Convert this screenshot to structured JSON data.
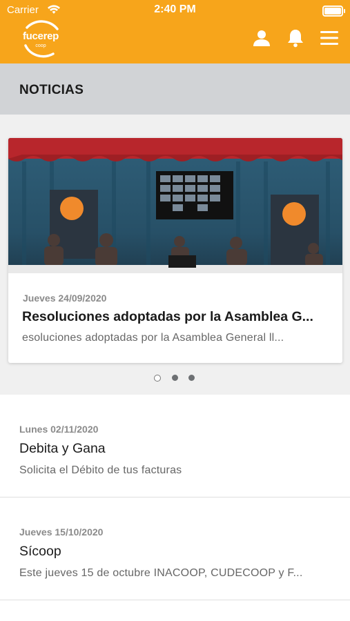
{
  "status_bar": {
    "carrier": "Carrier",
    "time": "2:40 PM"
  },
  "header": {
    "logo_text": "fucerep",
    "logo_sub": "coop",
    "brand_color": "#f7a51b",
    "icons": [
      "user-icon",
      "bell-icon",
      "menu-icon"
    ]
  },
  "section": {
    "title": "NOTICIAS"
  },
  "carousel": {
    "featured": {
      "date": "Jueves 24/09/2020",
      "title": "Resoluciones adoptadas por la Asamblea G...",
      "subtitle": "esoluciones adoptadas por la Asamblea General ll..."
    },
    "pages_total": 3,
    "active_index": 0
  },
  "news": [
    {
      "date": "Lunes 02/11/2020",
      "title": "Debita y Gana",
      "description": "Solicita el Débito de tus facturas"
    },
    {
      "date": "Jueves 15/10/2020",
      "title": "Sícoop",
      "description": "Este jueves 15 de octubre INACOOP, CUDECOOP y F..."
    }
  ]
}
